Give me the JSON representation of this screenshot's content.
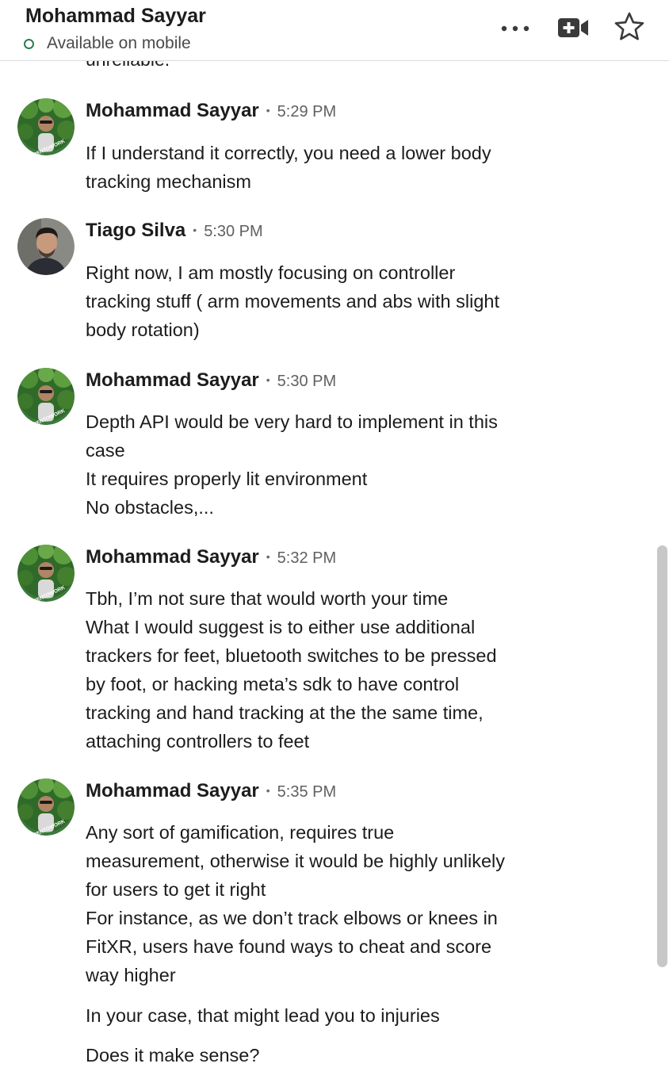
{
  "header": {
    "name": "Mohammad Sayyar",
    "status": "Available on mobile"
  },
  "partial_previous_line": "unreliable.",
  "messages": [
    {
      "sender": "Mohammad Sayyar",
      "sep": "•",
      "time": "5:29 PM",
      "lines": [
        "If I understand it correctly, you need a lower body",
        "tracking mechanism"
      ]
    },
    {
      "sender": "Tiago Silva",
      "sep": "•",
      "time": "5:30 PM",
      "lines": [
        "Right now, I am mostly focusing on controller",
        "tracking stuff ( arm movements and abs with slight",
        "body rotation)"
      ]
    },
    {
      "sender": "Mohammad Sayyar",
      "sep": "•",
      "time": "5:30 PM",
      "lines": [
        "Depth API would be very hard to implement in this",
        "case",
        "It requires properly lit environment",
        "No obstacles,..."
      ]
    },
    {
      "sender": "Mohammad Sayyar",
      "sep": "•",
      "time": "5:32 PM",
      "lines": [
        "Tbh, I’m not sure that would worth your time",
        "What I would suggest is to either use additional",
        "trackers for feet, bluetooth switches to be pressed",
        "by foot, or hacking meta’s sdk to have control",
        "tracking and hand tracking at the the same time,",
        "attaching controllers to feet"
      ]
    },
    {
      "sender": "Mohammad Sayyar",
      "sep": "•",
      "time": "5:35 PM",
      "lines": [
        "Any sort of gamification, requires true",
        "measurement, otherwise it would be highly unlikely",
        "for users to get it right",
        "For instance, as we don’t track elbows or knees in",
        "FitXR, users have found ways to cheat and score",
        "way higher",
        "In your case, that might lead you to injuries",
        "Does it make sense?"
      ]
    }
  ],
  "avatar_badge_text": "OPENTOWORK",
  "colors": {
    "status_green": "#2e7d4f",
    "open_to_work_green": "#3b7a3b",
    "text": "#1d1c1d",
    "timestamp": "#616061"
  },
  "icons": [
    "more-icon",
    "video-add-icon",
    "star-icon"
  ]
}
